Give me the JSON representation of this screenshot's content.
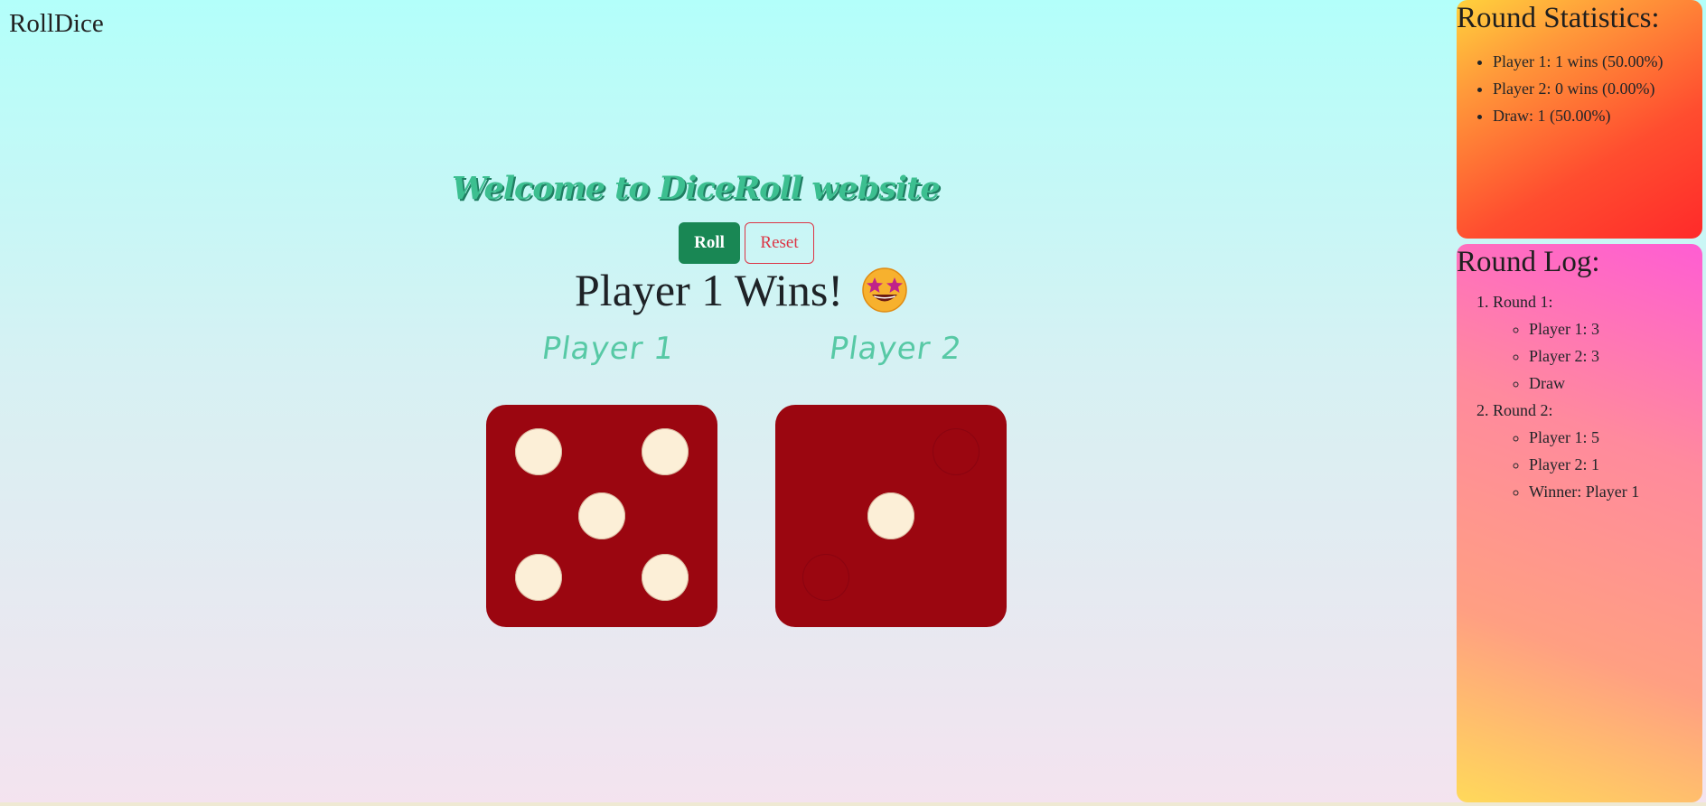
{
  "brand": "RollDice",
  "welcome": "Welcome to DiceRoll website",
  "buttons": {
    "roll": "Roll",
    "reset": "Reset"
  },
  "result": {
    "text": "Player 1 Wins!",
    "emoji": "star-struck-emoji"
  },
  "players": [
    {
      "label": "Player 1",
      "die_value": 5
    },
    {
      "label": "Player 2",
      "die_value": 1
    }
  ],
  "stats": {
    "title": "Round Statistics:",
    "items": [
      "Player 1: 1 wins (50.00%)",
      "Player 2: 0 wins (0.00%)",
      "Draw: 1 (50.00%)"
    ]
  },
  "log": {
    "title": "Round Log:",
    "rounds": [
      {
        "label": "Round 1:",
        "entries": [
          "Player 1: 3",
          "Player 2: 3",
          "Draw"
        ]
      },
      {
        "label": "Round 2:",
        "entries": [
          "Player 1: 5",
          "Player 2: 1",
          "Winner: Player 1"
        ]
      }
    ]
  },
  "colors": {
    "die": "#9b0610",
    "pip": "#fcefd7",
    "roll_button": "#198754",
    "reset_button": "#dc3545",
    "heading": "#3cbf90"
  }
}
